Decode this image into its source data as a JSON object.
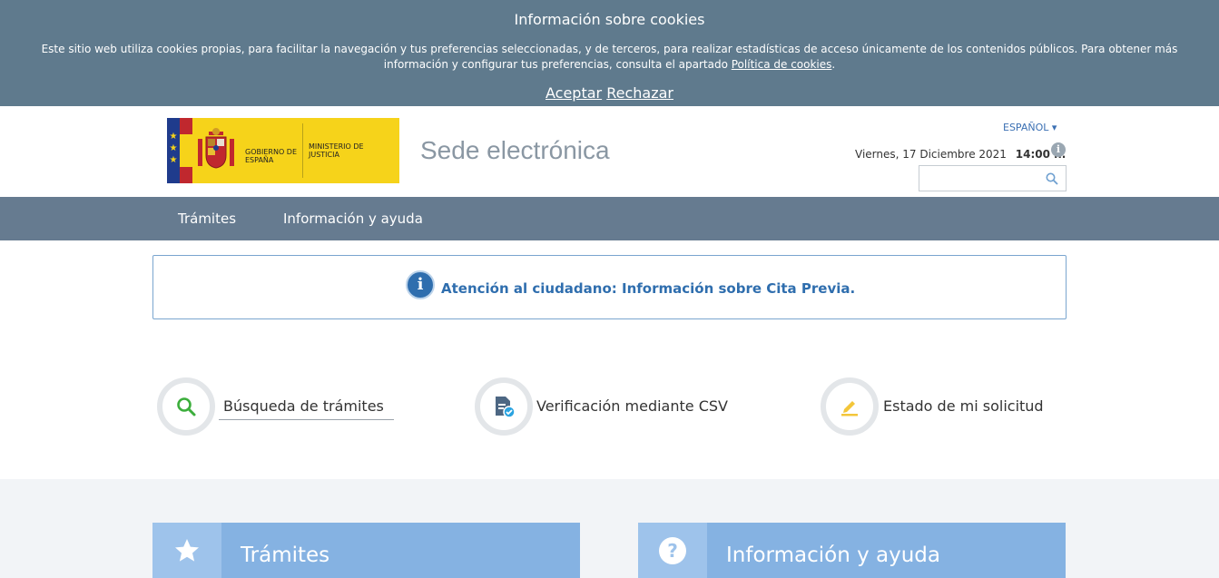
{
  "cookie_banner": {
    "title": "Información sobre cookies",
    "text": "Este sitio web utiliza cookies propias, para facilitar la navegación y tus preferencias seleccionadas, y de terceros, para realizar estadísticas de acceso únicamente de los contenidos públicos. Para obtener más información y configurar tus preferencias, consulta el apartado",
    "link": "Política de cookies",
    "text_end": ".",
    "accept": "Aceptar",
    "reject": "Rechazar"
  },
  "header": {
    "logo_left": "GOBIERNO DE ESPAÑA",
    "logo_right": "MINISTERIO DE JUSTICIA",
    "title": "Sede electrónica",
    "language": "ESPAÑOL ▾",
    "date": "Viernes, 17 Diciembre 2021",
    "time": "14:00 h.",
    "search_placeholder": ""
  },
  "nav": {
    "items": [
      "Trámites",
      "Información y ayuda"
    ]
  },
  "alert": {
    "text": "Atención al ciudadano: Información sobre Cita Previa."
  },
  "quick_actions": [
    {
      "label": "Búsqueda de trámites",
      "icon": "search-icon"
    },
    {
      "label": "Verificación mediante CSV",
      "icon": "document-check-icon"
    },
    {
      "label": "Estado de mi solicitud",
      "icon": "pencil-icon"
    }
  ],
  "cards": [
    {
      "title": "Trámites",
      "icon": "star-icon"
    },
    {
      "title": "Información y ayuda",
      "icon": "question-icon"
    }
  ],
  "colors": {
    "banner": "#5f7a8d",
    "nav": "#667b90",
    "accent": "#2f6eae",
    "card": "#85b2e2"
  }
}
